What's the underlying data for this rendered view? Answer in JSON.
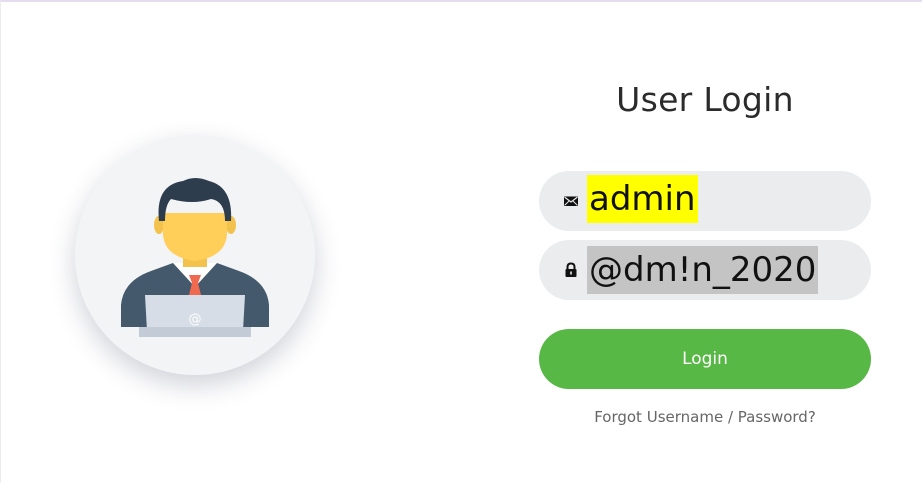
{
  "login": {
    "title": "User Login",
    "username_value": "admin",
    "password_value": "@dm!n_2020",
    "button_label": "Login",
    "forgot_link": "Forgot Username / Password?"
  },
  "icons": {
    "username_icon": "envelope-icon",
    "password_icon": "lock-icon",
    "avatar": "user-avatar-illustration"
  },
  "colors": {
    "accent": "#57b846",
    "field_background": "#ebeced",
    "username_highlight": "#ffff00",
    "password_highlight": "#c4c4c4"
  }
}
